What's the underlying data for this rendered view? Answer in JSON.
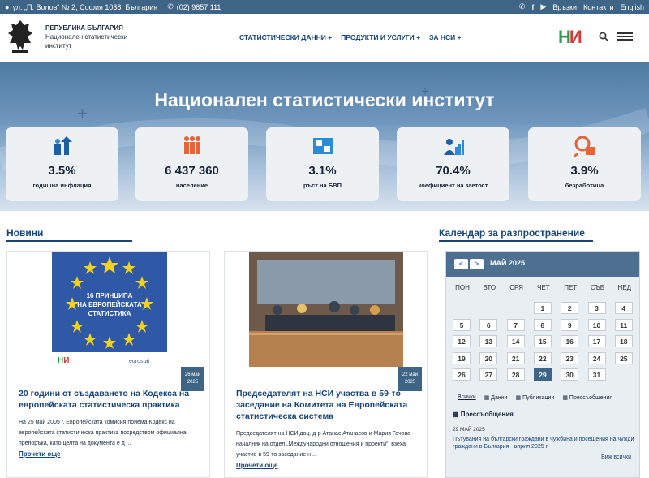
{
  "topbar": {
    "address": "ул. „П. Волов“ № 2, София 1038, България",
    "phone": "(02) 9857 111",
    "links": [
      "Връзки",
      "Контакти",
      "English"
    ]
  },
  "logo": {
    "line1": "РЕПУБЛИКА БЪЛГАРИЯ",
    "line2": "Национален статистически",
    "line3": "институт"
  },
  "nav": [
    {
      "label": "СТАТИСТИЧЕСКИ ДАННИ +"
    },
    {
      "label": "ПРОДУКТИ И УСЛУГИ +"
    },
    {
      "label": "ЗА НСИ +"
    }
  ],
  "nsi_logo": "НИ",
  "hero": {
    "title": "Национален статистически институт"
  },
  "indicators": [
    {
      "value": "3.5%",
      "label": "годишна инфлация",
      "icon": "inflation-icon"
    },
    {
      "value": "6 437 360",
      "label": "население",
      "icon": "population-icon"
    },
    {
      "value": "3.1%",
      "label": "ръст на БВП",
      "icon": "gdp-icon"
    },
    {
      "value": "70.4%",
      "label": "коефициент на заетост",
      "icon": "employment-icon"
    },
    {
      "value": "3.9%",
      "label": "безработица",
      "icon": "unemployment-icon"
    }
  ],
  "news_section": {
    "title": "Новини"
  },
  "calendar_section": {
    "title": "Календар за разпространение"
  },
  "news": [
    {
      "image_text": [
        "16 ПРИНЦИПА",
        "НА ЕВРОПЕЙСКАТА",
        "СТАТИСТИКА"
      ],
      "image_caption": "eurostat",
      "date": [
        "26 май",
        "2025"
      ],
      "title": "20 години от създаването на Кодекса на европейската статистическа практика",
      "text": "На 25 май 2005 г. Европейската комисия приема Кодекс на европейската статистическа практика посредством официална препоръка, като целта на документа е д ...",
      "more": "Прочети още"
    },
    {
      "date": [
        "22 май",
        "2025"
      ],
      "title": "Председателят на НСИ участва в 59-то заседание на Комитета на Европейската статистическа система",
      "text": "Председателят на НСИ доц. д-р Атанас Атанасов и Мария Гочова - началник на отдел „Международни отношения и проекти“, взеха участие в 59-то заседание н ...",
      "more": "Прочети още"
    }
  ],
  "calendar": {
    "prev": "<",
    "next": ">",
    "month": "МАЙ 2025",
    "weekdays": [
      "ПОН",
      "ВТО",
      "СРЯ",
      "ЧЕТ",
      "ПЕТ",
      "СЪБ",
      "НЕД"
    ],
    "days": [
      "1",
      "2",
      "3",
      "4",
      "5",
      "6",
      "7",
      "8",
      "9",
      "10",
      "11",
      "12",
      "13",
      "14",
      "15",
      "16",
      "17",
      "18",
      "19",
      "20",
      "21",
      "22",
      "23",
      "24",
      "25",
      "26",
      "27",
      "28",
      "29",
      "30",
      "31"
    ],
    "today": "29",
    "tabs": [
      "Всички",
      "Данни",
      "Публикации",
      "Прессъобщения"
    ],
    "press_title": "Прессъобщения",
    "press_date": "29 МАЙ 2025",
    "press_link": "Пътувания на български граждани в чужбина и посещения на чужди граждани в България - април 2025 г.",
    "see_all": "Виж всички"
  }
}
